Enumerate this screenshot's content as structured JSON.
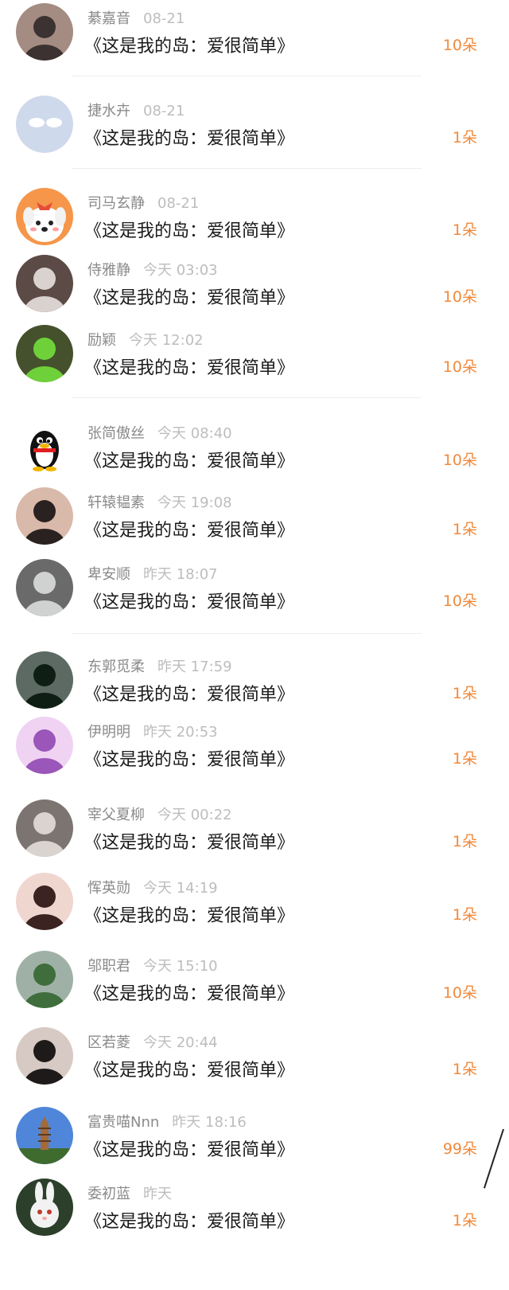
{
  "rows": [
    {
      "name": "綦嘉音",
      "time": "08-21",
      "title": "《这是我的岛：爱很简单》",
      "count": "10朵",
      "avatar": "photo-woman",
      "c1": "#3b3231",
      "c2": "#a58c83"
    },
    {
      "name": "捷水卉",
      "time": "08-21",
      "title": "《这是我的岛：爱很简单》",
      "count": "1朵",
      "avatar": "clouds-icon",
      "c1": "#cfd9ec",
      "c2": "#eef2fa"
    },
    {
      "name": "司马玄静",
      "time": "08-21",
      "title": "《这是我的岛：爱很简单》",
      "count": "1朵",
      "avatar": "cartoon-dog",
      "c1": "#f5964a",
      "c2": "#ffffff"
    },
    {
      "name": "侍雅静",
      "time": "今天 03:03",
      "title": "《这是我的岛：爱很简单》",
      "count": "10朵",
      "avatar": "photo-woman",
      "c1": "#d9d2cf",
      "c2": "#5b4a45"
    },
    {
      "name": "励颖",
      "time": "今天 12:02",
      "title": "《这是我的岛：爱很简单》",
      "count": "10朵",
      "avatar": "photo-green",
      "c1": "#6fd13a",
      "c2": "#45512c"
    },
    {
      "name": "张简傲丝",
      "time": "今天 08:40",
      "title": "《这是我的岛：爱很简单》",
      "count": "10朵",
      "avatar": "qq-penguin",
      "c1": "#111111",
      "c2": "#f3b400"
    },
    {
      "name": "轩辕韫素",
      "time": "今天 19:08",
      "title": "《这是我的岛：爱很简单》",
      "count": "1朵",
      "avatar": "photo-glasses",
      "c1": "#2a2220",
      "c2": "#d9b9aa"
    },
    {
      "name": "卑安顺",
      "time": "昨天 18:07",
      "title": "《这是我的岛：爱很简单》",
      "count": "10朵",
      "avatar": "photo-group",
      "c1": "#cfd2d0",
      "c2": "#6b6a6a"
    },
    {
      "name": "东郭觅柔",
      "time": "昨天 17:59",
      "title": "《这是我的岛：爱很简单》",
      "count": "1朵",
      "avatar": "photo-dark",
      "c1": "#0e1e15",
      "c2": "#5c6a63"
    },
    {
      "name": "伊明明",
      "time": "昨天 20:53",
      "title": "《这是我的岛：爱很简单》",
      "count": "1朵",
      "avatar": "photo-purple",
      "c1": "#9a56b8",
      "c2": "#f0d3f3"
    },
    {
      "name": "宰父夏柳",
      "time": "今天 00:22",
      "title": "《这是我的岛：爱很简单》",
      "count": "1朵",
      "avatar": "photo-cat",
      "c1": "#d9d4d0",
      "c2": "#7c7470"
    },
    {
      "name": "恽英勋",
      "time": "今天 14:19",
      "title": "《这是我的岛：爱很简单》",
      "count": "1朵",
      "avatar": "photo-woman",
      "c1": "#3a2320",
      "c2": "#efd6cf"
    },
    {
      "name": "邬职君",
      "time": "今天 15:10",
      "title": "《这是我的岛：爱很简单》",
      "count": "10朵",
      "avatar": "photo-outdoor",
      "c1": "#3f6d3c",
      "c2": "#9fb1a6"
    },
    {
      "name": "区若菱",
      "time": "今天 20:44",
      "title": "《这是我的岛：爱很简单》",
      "count": "1朵",
      "avatar": "photo-woman",
      "c1": "#1e1a1a",
      "c2": "#d7c9c3"
    },
    {
      "name": "富贵喵Nnn",
      "time": "昨天 18:16",
      "title": "《这是我的岛：爱很简单》",
      "count": "99朵",
      "avatar": "photo-pagoda",
      "c1": "#4f86d9",
      "c2": "#a46a3a"
    },
    {
      "name": "委初蓝",
      "time": "昨天",
      "title": "《这是我的岛：爱很简单》",
      "count": "1朵",
      "avatar": "bunny-icon",
      "c1": "#2b3f2a",
      "c2": "#f2f2f2"
    }
  ]
}
